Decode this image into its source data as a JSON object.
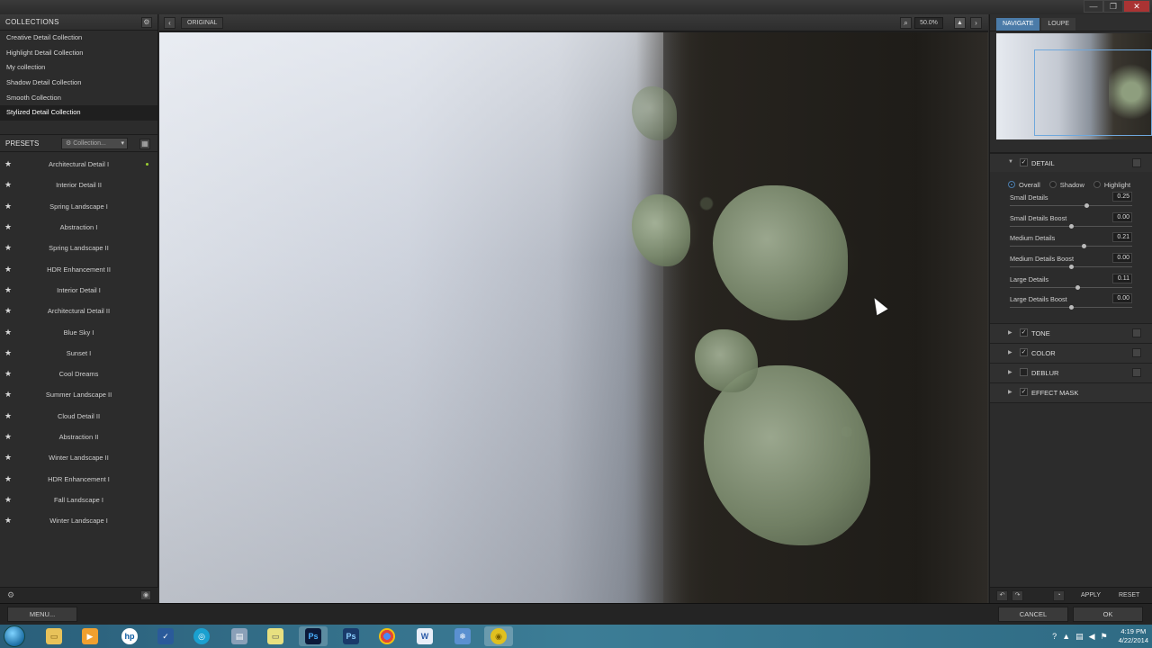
{
  "window": {
    "controls": [
      "—",
      "❐",
      "✕"
    ]
  },
  "collections": {
    "title": "COLLECTIONS",
    "items": [
      "Creative Detail Collection",
      "Highlight Detail Collection",
      "My collection",
      "Shadow Detail Collection",
      "Smooth Collection",
      "Stylized Detail Collection"
    ],
    "active_index": 5
  },
  "presets": {
    "title": "PRESETS",
    "dropdown_value": "Collection...",
    "items": [
      "Architectural Detail I",
      "Interior Detail II",
      "Spring Landscape I",
      "Abstraction I",
      "Spring Landscape II",
      "HDR Enhancement II",
      "Interior Detail I",
      "Architectural Detail II",
      "Blue Sky I",
      "Sunset I",
      "Cool Dreams",
      "Summer Landscape II",
      "Cloud Detail II",
      "Abstraction II",
      "Winter Landscape II",
      "HDR Enhancement I",
      "Fall Landscape I",
      "Winter Landscape I"
    ]
  },
  "canvas_bar": {
    "original_label": "ORIGINAL",
    "zoom": "50.0%"
  },
  "navigator": {
    "tabs": [
      "NAVIGATE",
      "LOUPE"
    ],
    "active_tab": 0
  },
  "detail": {
    "title": "DETAIL",
    "modes": [
      "Overall",
      "Shadow",
      "Highlight"
    ],
    "sliders": [
      {
        "label": "Small Details",
        "value": "0.25",
        "pos": 0.625
      },
      {
        "label": "Small Details Boost",
        "value": "0.00",
        "pos": 0.5
      },
      {
        "label": "Medium Details",
        "value": "0.21",
        "pos": 0.605
      },
      {
        "label": "Medium Details Boost",
        "value": "0.00",
        "pos": 0.5
      },
      {
        "label": "Large Details",
        "value": "0.11",
        "pos": 0.555
      },
      {
        "label": "Large Details Boost",
        "value": "0.00",
        "pos": 0.5
      }
    ]
  },
  "sections": [
    {
      "name": "TONE",
      "checked": true
    },
    {
      "name": "COLOR",
      "checked": true
    },
    {
      "name": "DEBLUR",
      "checked": false
    },
    {
      "name": "EFFECT MASK",
      "checked": true
    }
  ],
  "rp_footer": {
    "apply": "APPLY",
    "reset": "RESET"
  },
  "bottom": {
    "menu": "MENU...",
    "cancel": "CANCEL",
    "ok": "OK"
  },
  "taskbar": {
    "time": "4:19 PM",
    "date": "4/22/2014"
  },
  "colors": {
    "accent": "#4b7ba8",
    "nav_frame": "#6fa8dc",
    "preset_dot": "#9acd32"
  }
}
